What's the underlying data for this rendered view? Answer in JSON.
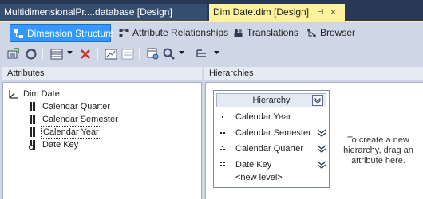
{
  "tabs": {
    "inactive_title": "MultidimensionalPr....database [Design]",
    "active_title": "Dim Date.dim [Design]",
    "pin_glyph": "⊣",
    "close_glyph": "×"
  },
  "subtabs": {
    "dimension_structure": "Dimension Structure",
    "attribute_relationships": "Attribute Relationships",
    "translations": "Translations",
    "browser": "Browser"
  },
  "attributes_pane": {
    "header": "Attributes",
    "dimension": "Dim Date",
    "items": [
      "Calendar Quarter",
      "Calendar Semester",
      "Calendar Year",
      "Date Key"
    ],
    "selected": "Calendar Year"
  },
  "hierarchies_pane": {
    "header": "Hierarchies",
    "hierarchy_title": "Hierarchy",
    "levels": [
      "Calendar Year",
      "Calendar Semester",
      "Calendar Quarter",
      "Date Key"
    ],
    "new_level": "<new level>",
    "hint": "To create a new hierarchy, drag an attribute here."
  },
  "colors": {
    "chrome_dark": "#293955",
    "tab_active": "#fff29d",
    "designer_bg": "#cfd6e5",
    "subtab_selected": "#3399ff"
  }
}
